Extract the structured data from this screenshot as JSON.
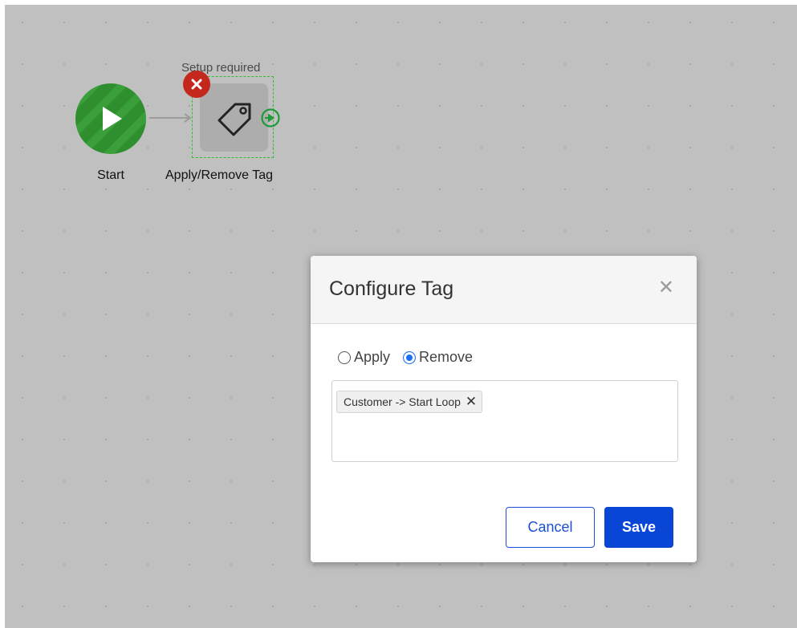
{
  "canvas": {
    "start_node": {
      "label": "Start",
      "icon": "play-icon",
      "color": "#2f8f2f"
    },
    "tag_node": {
      "status": "Setup required",
      "label": "Apply/Remove Tag",
      "icon": "tag-icon",
      "remove_icon": "close-icon",
      "out_port_icon": "arrow-right-circle-icon"
    }
  },
  "modal": {
    "title": "Configure Tag",
    "close_icon": "close-icon",
    "options": [
      {
        "label": "Apply",
        "checked": false
      },
      {
        "label": "Remove",
        "checked": true
      }
    ],
    "selected_tags": [
      {
        "label": "Customer -> Start Loop"
      }
    ],
    "cancel_label": "Cancel",
    "save_label": "Save",
    "colors": {
      "primary": "#0a46d6",
      "error": "#c4271b",
      "success": "#2fbf2f"
    }
  }
}
